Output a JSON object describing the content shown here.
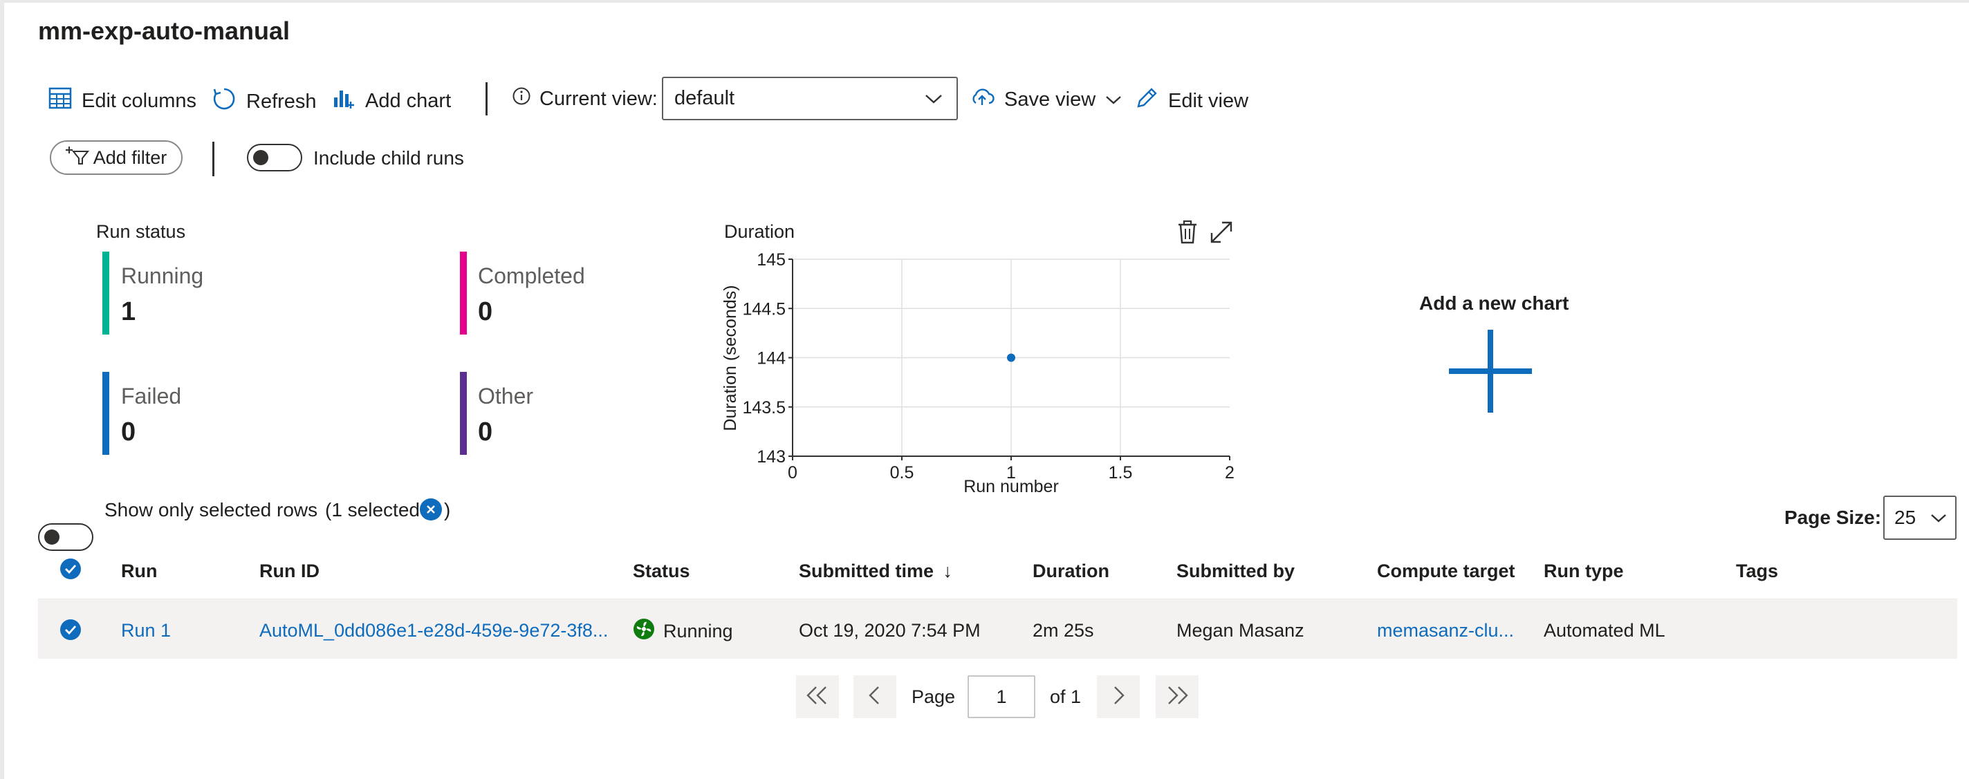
{
  "page": {
    "title": "mm-exp-auto-manual"
  },
  "toolbar": {
    "edit_columns": "Edit columns",
    "refresh": "Refresh",
    "add_chart": "Add chart",
    "current_view_label": "Current view:",
    "current_view_value": "default",
    "save_view": "Save view",
    "edit_view": "Edit view"
  },
  "filters": {
    "add_filter": "Add filter",
    "include_child_runs": "Include child runs",
    "include_child_runs_on": false
  },
  "run_status": {
    "title": "Run status",
    "items": [
      {
        "label": "Running",
        "value": "1",
        "color": "#00b294"
      },
      {
        "label": "Completed",
        "value": "0",
        "color": "#e3008c"
      },
      {
        "label": "Failed",
        "value": "0",
        "color": "#0f6cbd"
      },
      {
        "label": "Other",
        "value": "0",
        "color": "#5c2e91"
      }
    ]
  },
  "duration_chart": {
    "title": "Duration",
    "delete_icon": "trash-icon",
    "expand_icon": "expand-icon"
  },
  "chart_data": {
    "type": "scatter",
    "title": "Duration",
    "xlabel": "Run number",
    "ylabel": "Duration (seconds)",
    "xlim": [
      0,
      2
    ],
    "ylim": [
      143,
      145
    ],
    "xticks": [
      "0",
      "0.5",
      "1",
      "1.5",
      "2"
    ],
    "yticks": [
      "145",
      "144.5",
      "144",
      "143.5",
      "143"
    ],
    "x": [
      1
    ],
    "y": [
      144
    ],
    "color": "#0f6cbd",
    "grid": true
  },
  "add_new_chart": {
    "label": "Add a new chart"
  },
  "selection": {
    "show_only_selected": "Show only selected rows",
    "selected_count": "(1 selected",
    "close_paren": ")"
  },
  "page_size": {
    "label": "Page Size:",
    "value": "25"
  },
  "table": {
    "headers": {
      "run": "Run",
      "run_id": "Run ID",
      "status": "Status",
      "submitted_time": "Submitted time",
      "sort_arrow": "↓",
      "duration": "Duration",
      "submitted_by": "Submitted by",
      "compute_target": "Compute target",
      "run_type": "Run type",
      "tags": "Tags"
    },
    "rows": [
      {
        "run": "Run 1",
        "run_id": "AutoML_0dd086e1-e28d-459e-9e72-3f8...",
        "status": "Running",
        "submitted_time": "Oct 19, 2020 7:54 PM",
        "duration": "2m 25s",
        "submitted_by": "Megan Masanz",
        "compute_target": "memasanz-clu...",
        "run_type": "Automated ML",
        "tags": ""
      }
    ]
  },
  "pager": {
    "page_label": "Page",
    "current_page": "1",
    "of_label": "of 1"
  },
  "colors": {
    "accent": "#0f6cbd",
    "running_green": "#107c10"
  }
}
